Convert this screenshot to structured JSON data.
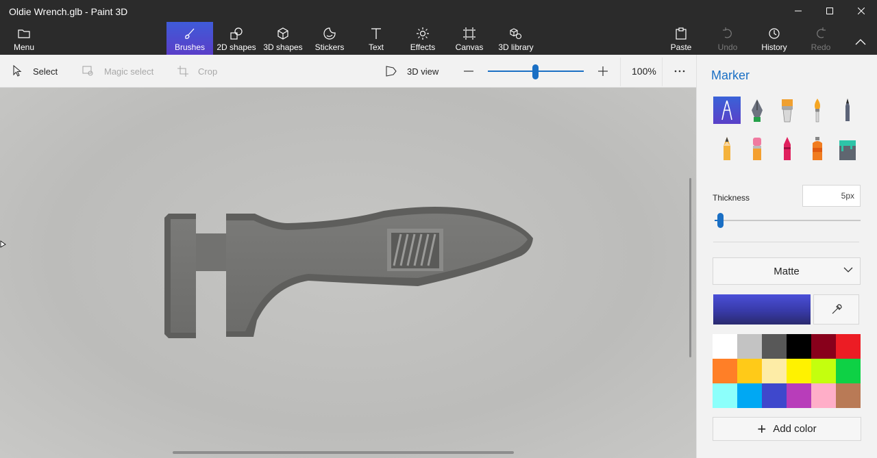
{
  "window": {
    "title": "Oldie Wrench.glb - Paint 3D"
  },
  "ribbon": {
    "menu": "Menu",
    "tools": [
      "Brushes",
      "2D shapes",
      "3D shapes",
      "Stickers",
      "Text",
      "Effects",
      "Canvas",
      "3D library"
    ],
    "active_tool": "Brushes",
    "right": [
      "Paste",
      "Undo",
      "History",
      "Redo"
    ]
  },
  "toolbar": {
    "select": "Select",
    "magic_select": "Magic select",
    "crop": "Crop",
    "view3d": "3D view",
    "zoom": "100%",
    "zoom_level": 0.5
  },
  "panel": {
    "title": "Marker",
    "brushes": [
      "marker",
      "calligraphy-pen",
      "oil-brush",
      "watercolor",
      "pixel-pen",
      "pencil",
      "eraser",
      "crayon",
      "spray-can",
      "fill"
    ],
    "selected_brush": "marker",
    "thickness_label": "Thickness",
    "thickness_value": "5px",
    "thickness_level": 0.02,
    "finish": "Matte",
    "current_color": "#3f41c0",
    "palette": [
      "#ffffff",
      "#c3c3c3",
      "#585858",
      "#000000",
      "#88001b",
      "#ec1c24",
      "#ff7f27",
      "#ffca18",
      "#fdeca6",
      "#fff200",
      "#c4ff0e",
      "#0ed145",
      "#8cfffb",
      "#00a8f3",
      "#3f48cc",
      "#b83dba",
      "#ffaec8",
      "#b97a56"
    ],
    "add_color": "Add color"
  },
  "icons": {
    "menu": "folder-icon",
    "brushes": "brush-icon",
    "shapes2d": "2d-shapes-icon",
    "shapes3d": "cube-icon",
    "stickers": "sticker-icon",
    "text": "text-icon",
    "effects": "sun-icon",
    "canvas": "canvas-icon",
    "library": "3d-library-icon",
    "paste": "clipboard-icon",
    "undo": "undo-icon",
    "history": "history-icon",
    "redo": "redo-icon",
    "collapse": "chevron-up-icon"
  }
}
